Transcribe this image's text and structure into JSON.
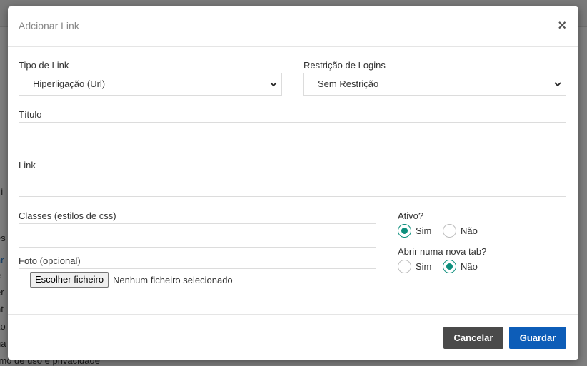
{
  "background": {
    "lines": [
      "Li",
      "es",
      "ar",
      "e",
      "er",
      "nt",
      "ito",
      "na",
      "rmo de uso e privacidade"
    ]
  },
  "modal": {
    "title": "Adcionar Link",
    "close_glyph": "×",
    "link_type": {
      "label": "Tipo de Link",
      "value": "Hiperligação (Url)"
    },
    "login_restriction": {
      "label": "Restrição de Logins",
      "value": "Sem Restrição"
    },
    "title_field": {
      "label": "Título",
      "value": ""
    },
    "link_field": {
      "label": "Link",
      "value": ""
    },
    "classes_field": {
      "label": "Classes (estilos de css)",
      "value": ""
    },
    "photo_field": {
      "label": "Foto (opcional)",
      "button": "Escolher ficheiro",
      "status": "Nenhum ficheiro selecionado"
    },
    "active": {
      "label": "Ativo?",
      "options": [
        {
          "label": "Sim",
          "checked": true
        },
        {
          "label": "Não",
          "checked": false
        }
      ]
    },
    "new_tab": {
      "label": "Abrir numa nova tab?",
      "options": [
        {
          "label": "Sim",
          "checked": false
        },
        {
          "label": "Não",
          "checked": true
        }
      ]
    },
    "buttons": {
      "cancel": "Cancelar",
      "save": "Guardar"
    }
  },
  "colors": {
    "radio_checked": "#0d8f7d",
    "save_button": "#0d5db8",
    "cancel_button": "#4a4a4a"
  }
}
